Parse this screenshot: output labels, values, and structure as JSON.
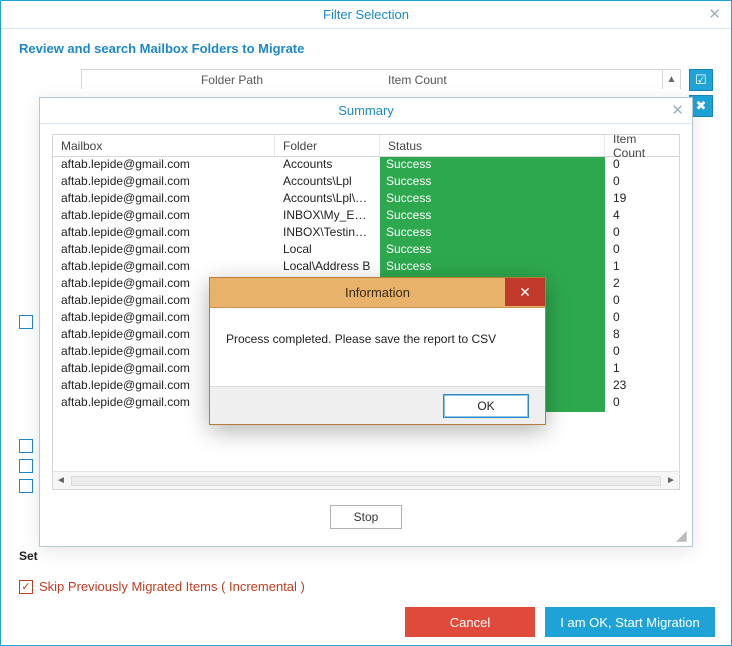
{
  "filter_window": {
    "title": "Filter Selection",
    "review_label": "Review and search Mailbox Folders to Migrate",
    "columns": {
      "path": "Folder Path",
      "count": "Item Count"
    },
    "set_label": "Set",
    "skip_label": "Skip Previously Migrated Items ( Incremental )"
  },
  "buttons": {
    "cancel": "Cancel",
    "start": "I am OK, Start Migration",
    "stop": "Stop",
    "ok": "OK"
  },
  "summary": {
    "title": "Summary",
    "headers": {
      "mailbox": "Mailbox",
      "folder": "Folder",
      "status": "Status",
      "count": "Item Count"
    },
    "rows": [
      {
        "mailbox": "aftab.lepide@gmail.com",
        "folder": "Accounts",
        "status": "Success",
        "count": "0"
      },
      {
        "mailbox": "aftab.lepide@gmail.com",
        "folder": "Accounts\\Lpl",
        "status": "Success",
        "count": "0"
      },
      {
        "mailbox": "aftab.lepide@gmail.com",
        "folder": "Accounts\\Lpl\\N...",
        "status": "Success",
        "count": "19"
      },
      {
        "mailbox": "aftab.lepide@gmail.com",
        "folder": "INBOX\\My_Emails",
        "status": "Success",
        "count": "4"
      },
      {
        "mailbox": "aftab.lepide@gmail.com",
        "folder": "INBOX\\Testing M",
        "status": "Success",
        "count": "0"
      },
      {
        "mailbox": "aftab.lepide@gmail.com",
        "folder": "Local",
        "status": "Success",
        "count": "0"
      },
      {
        "mailbox": "aftab.lepide@gmail.com",
        "folder": "Local\\Address B",
        "status": "Success",
        "count": "1"
      },
      {
        "mailbox": "aftab.lepide@gmail.com",
        "folder": "",
        "status": "",
        "count": "2"
      },
      {
        "mailbox": "aftab.lepide@gmail.com",
        "folder": "",
        "status": "",
        "count": "0"
      },
      {
        "mailbox": "aftab.lepide@gmail.com",
        "folder": "",
        "status": "",
        "count": "0"
      },
      {
        "mailbox": "aftab.lepide@gmail.com",
        "folder": "",
        "status": "",
        "count": "8"
      },
      {
        "mailbox": "aftab.lepide@gmail.com",
        "folder": "",
        "status": "",
        "count": "0"
      },
      {
        "mailbox": "aftab.lepide@gmail.com",
        "folder": "",
        "status": "",
        "count": "1"
      },
      {
        "mailbox": "aftab.lepide@gmail.com",
        "folder": "",
        "status": "",
        "count": "23"
      },
      {
        "mailbox": "aftab.lepide@gmail.com",
        "folder": "",
        "status": "",
        "count": "0"
      }
    ]
  },
  "msgbox": {
    "title": "Information",
    "message": "Process completed. Please save the report to CSV"
  }
}
